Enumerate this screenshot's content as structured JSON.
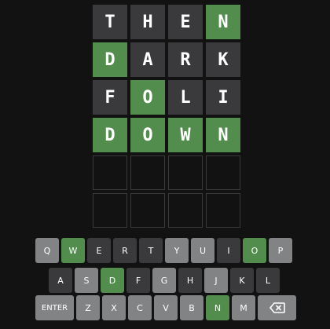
{
  "board": {
    "rows": [
      [
        {
          "letter": "T",
          "state": "absent"
        },
        {
          "letter": "H",
          "state": "absent"
        },
        {
          "letter": "E",
          "state": "absent"
        },
        {
          "letter": "N",
          "state": "correct"
        }
      ],
      [
        {
          "letter": "D",
          "state": "correct"
        },
        {
          "letter": "A",
          "state": "absent"
        },
        {
          "letter": "R",
          "state": "absent"
        },
        {
          "letter": "K",
          "state": "absent"
        }
      ],
      [
        {
          "letter": "F",
          "state": "absent"
        },
        {
          "letter": "O",
          "state": "correct"
        },
        {
          "letter": "L",
          "state": "absent"
        },
        {
          "letter": "I",
          "state": "absent"
        }
      ],
      [
        {
          "letter": "D",
          "state": "correct"
        },
        {
          "letter": "O",
          "state": "correct"
        },
        {
          "letter": "W",
          "state": "correct"
        },
        {
          "letter": "N",
          "state": "correct"
        }
      ],
      [
        {
          "letter": "",
          "state": "empty"
        },
        {
          "letter": "",
          "state": "empty"
        },
        {
          "letter": "",
          "state": "empty"
        },
        {
          "letter": "",
          "state": "empty"
        }
      ],
      [
        {
          "letter": "",
          "state": "empty"
        },
        {
          "letter": "",
          "state": "empty"
        },
        {
          "letter": "",
          "state": "empty"
        },
        {
          "letter": "",
          "state": "empty"
        }
      ]
    ]
  },
  "keyboard": {
    "rows": [
      [
        {
          "label": "Q",
          "state": "unused"
        },
        {
          "label": "W",
          "state": "correct"
        },
        {
          "label": "E",
          "state": "absent"
        },
        {
          "label": "R",
          "state": "absent"
        },
        {
          "label": "T",
          "state": "absent"
        },
        {
          "label": "Y",
          "state": "unused"
        },
        {
          "label": "U",
          "state": "unused"
        },
        {
          "label": "I",
          "state": "absent"
        },
        {
          "label": "O",
          "state": "correct"
        },
        {
          "label": "P",
          "state": "unused"
        }
      ],
      [
        {
          "label": "A",
          "state": "absent"
        },
        {
          "label": "S",
          "state": "unused"
        },
        {
          "label": "D",
          "state": "correct"
        },
        {
          "label": "F",
          "state": "absent"
        },
        {
          "label": "G",
          "state": "unused"
        },
        {
          "label": "H",
          "state": "absent"
        },
        {
          "label": "J",
          "state": "unused"
        },
        {
          "label": "K",
          "state": "absent"
        },
        {
          "label": "L",
          "state": "absent"
        }
      ],
      [
        {
          "label": "ENTER",
          "state": "unused",
          "kind": "enter"
        },
        {
          "label": "Z",
          "state": "unused"
        },
        {
          "label": "X",
          "state": "unused"
        },
        {
          "label": "C",
          "state": "unused"
        },
        {
          "label": "V",
          "state": "unused"
        },
        {
          "label": "B",
          "state": "unused"
        },
        {
          "label": "N",
          "state": "correct"
        },
        {
          "label": "M",
          "state": "unused"
        },
        {
          "label": "",
          "state": "unused",
          "kind": "backspace",
          "icon": "backspace-icon"
        }
      ]
    ]
  },
  "colors": {
    "background": "#121213",
    "correct": "#538d4e",
    "absent": "#3a3a3c",
    "unused_key": "#818384",
    "text": "#ffffff"
  }
}
